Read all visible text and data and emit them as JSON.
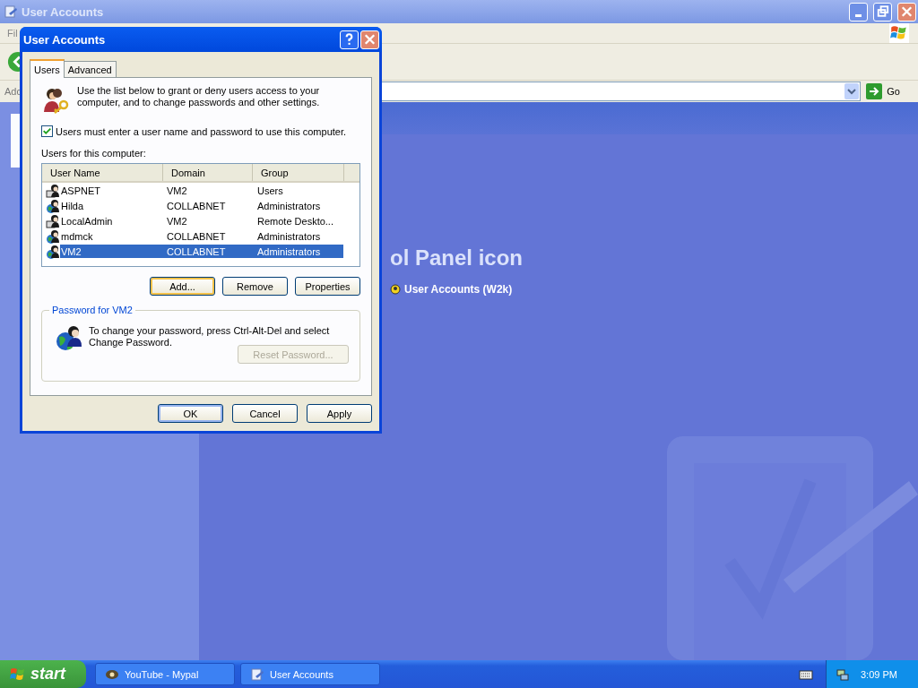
{
  "main_window": {
    "title": "User Accounts",
    "menu_item": "Fil",
    "address_label": "Add",
    "go_button": "Go",
    "heading": "ol Panel icon",
    "link": "User Accounts (W2k)"
  },
  "dialog": {
    "title": "User Accounts",
    "tabs": [
      {
        "label": "Users",
        "selected": true
      },
      {
        "label": "Advanced",
        "selected": false
      }
    ],
    "intro": "Use the list below to grant or deny users access to your computer, and to change passwords and other settings.",
    "require_login": {
      "label": "Users must enter a user name and password to use this computer.",
      "checked": true
    },
    "list_label": "Users for this computer:",
    "columns": [
      "User Name",
      "Domain",
      "Group"
    ],
    "rows": [
      {
        "kind": "local",
        "cells": [
          "ASPNET",
          "VM2",
          "Users"
        ],
        "selected": false
      },
      {
        "kind": "domain",
        "cells": [
          "Hilda",
          "COLLABNET",
          "Administrators"
        ],
        "selected": false
      },
      {
        "kind": "local",
        "cells": [
          "LocalAdmin",
          "VM2",
          "Remote Deskto..."
        ],
        "selected": false
      },
      {
        "kind": "domain",
        "cells": [
          "mdmck",
          "COLLABNET",
          "Administrators"
        ],
        "selected": false
      },
      {
        "kind": "domain",
        "cells": [
          "VM2",
          "COLLABNET",
          "Administrators"
        ],
        "selected": true
      }
    ],
    "list_buttons": [
      {
        "label": "Add...",
        "focused": true
      },
      {
        "label": "Remove",
        "focused": false
      },
      {
        "label": "Properties",
        "focused": false
      }
    ],
    "password_group": {
      "title": "Password for VM2",
      "text": "To change your password, press Ctrl-Alt-Del and select Change Password.",
      "button": {
        "label": "Reset Password...",
        "disabled": true
      }
    },
    "footer_buttons": [
      {
        "label": "OK",
        "default": true
      },
      {
        "label": "Cancel",
        "default": false
      },
      {
        "label": "Apply",
        "default": false
      }
    ]
  },
  "taskbar": {
    "start": "start",
    "tasks": [
      {
        "label": "YouTube - Mypal",
        "kind": "browser",
        "selected": false
      },
      {
        "label": "User Accounts",
        "kind": "accounts",
        "selected": false
      }
    ],
    "clock": "3:09 PM"
  }
}
